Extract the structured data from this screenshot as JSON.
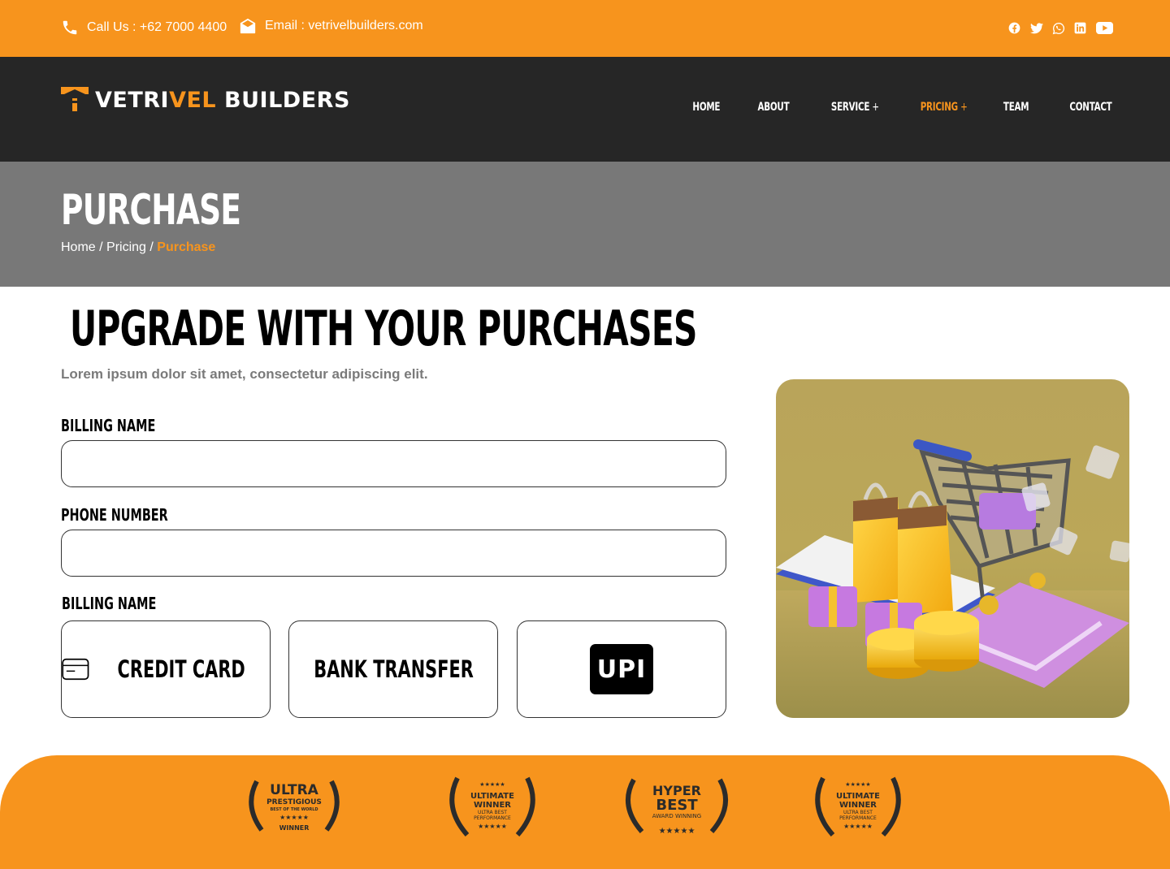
{
  "topbar": {
    "phone": "Call Us : +62 7000 4400",
    "email": "Email : vetrivelbuilders.com",
    "socials": [
      "facebook-icon",
      "twitter-icon",
      "whatsapp-icon",
      "linkedin-icon",
      "youtube-icon"
    ]
  },
  "header": {
    "logo_part1": "VETRI",
    "logo_part2": "VEL",
    "logo_part3": " BUILDERS",
    "nav": [
      {
        "label": "HOME"
      },
      {
        "label": "ABOUT"
      },
      {
        "label": "SERVICE",
        "plus": "+"
      },
      {
        "label": "PRICING",
        "plus": "+"
      },
      {
        "label": "TEAM"
      },
      {
        "label": "CONTACT"
      }
    ]
  },
  "banner": {
    "title": "PURCHASE",
    "crumb_home": "Home",
    "crumb_sep": " / ",
    "crumb_pricing": "Pricing",
    "crumb_current": "Purchase"
  },
  "main": {
    "title": "UPGRADE WITH YOUR PURCHASES",
    "subtitle": "Lorem ipsum dolor sit amet, consectetur adipiscing elit.",
    "field1_label": "BILLING NAME",
    "field1_value": "",
    "field2_label": "PHONE NUMBER",
    "field2_value": "",
    "payment_label": "BILLING NAME",
    "payment_options": {
      "credit_card": "CREDIT CARD",
      "bank_transfer": "BANK TRANSFER",
      "upi": "UPI"
    }
  },
  "awards": [
    {
      "top": "ULTRA",
      "mid": "PRESTIGIOUS",
      "small": "BEST OF THE WORLD",
      "stars": "★★★★★",
      "bottom": "WINNER"
    },
    {
      "stars_top": "★★★★★",
      "top": "ULTIMATE",
      "mid": "WINNER",
      "small": "ULTRA BEST",
      "small2": "PERFORMANCE",
      "stars": "★★★★★"
    },
    {
      "top": "HYPER",
      "mid": "BEST",
      "small": "AWARD WINNING",
      "stars": "★★★★★"
    },
    {
      "stars_top": "★★★★★",
      "top": "ULTIMATE",
      "mid": "WINNER",
      "small": "ULTRA BEST",
      "small2": "PERFORMANCE",
      "stars": "★★★★★"
    }
  ],
  "colors": {
    "accent": "#F7941D",
    "header": "#262626",
    "banner": "#787878"
  }
}
